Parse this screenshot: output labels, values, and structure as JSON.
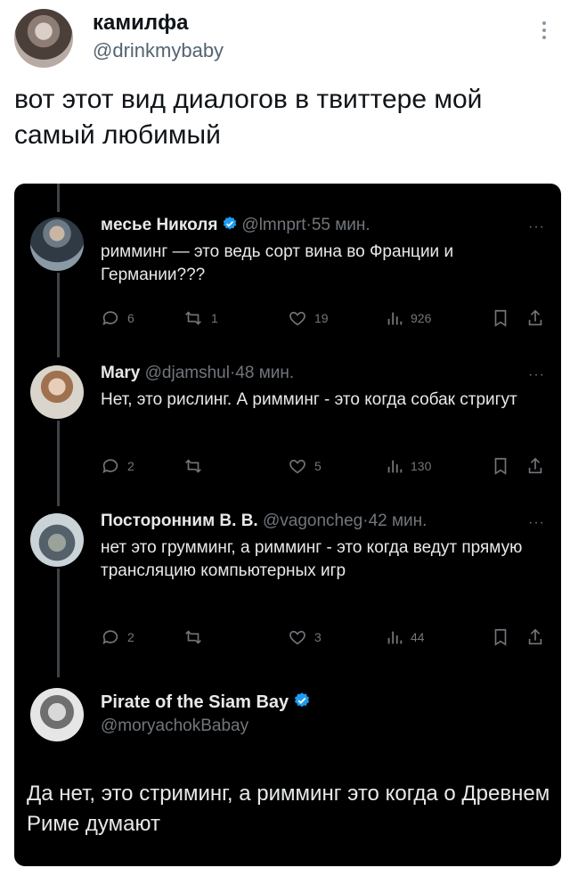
{
  "tweet": {
    "author_name": "камилфа",
    "author_handle": "@drinkmybaby",
    "text": "вот этот вид диалогов в твиттере мой самый любимый"
  },
  "screenshot": {
    "replies": [
      {
        "name": "месье Николя",
        "verified": true,
        "handle": "@lmnprt",
        "time": "55 мин.",
        "text": "римминг — это ведь сорт вина во Франции и Германии???",
        "replies": "6",
        "retweets": "1",
        "likes": "19",
        "views": "926"
      },
      {
        "name": "Mary",
        "verified": false,
        "handle": "@djamshul",
        "time": "48 мин.",
        "text": "Нет, это рислинг. А римминг - это когда собак стригут",
        "replies": "2",
        "retweets": "",
        "likes": "5",
        "views": "130"
      },
      {
        "name": "Посторонним В. В.",
        "verified": false,
        "handle": "@vagoncheg",
        "time": "42 мин.",
        "text": "нет это грумминг, а римминг - это когда ведут прямую трансляцию компьютерных игр",
        "replies": "2",
        "retweets": "",
        "likes": "3",
        "views": "44"
      }
    ],
    "final": {
      "name": "Pirate of the Siam Bay",
      "verified": true,
      "handle": "@moryachokBabay",
      "text": "Да нет, это стриминг, а римминг это когда о Древнем Риме думают"
    }
  },
  "colors": {
    "card_bg": "#000000",
    "verified_blue": "#1d9bf0",
    "muted": "#71767b"
  },
  "separator": "·",
  "more_glyph": "···"
}
